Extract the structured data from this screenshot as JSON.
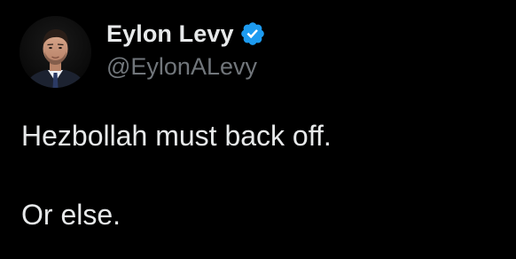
{
  "author": {
    "display_name": "Eylon Levy",
    "handle": "@EylonALevy",
    "verified": true,
    "avatar_icon": "profile-photo",
    "verified_icon": "verified-badge-icon"
  },
  "tweet": {
    "lines": [
      "Hezbollah must back off.",
      "Or else."
    ]
  },
  "colors": {
    "background": "#000000",
    "text_primary": "#e7e9ea",
    "text_secondary": "#71767b",
    "verified_badge": "#1d9bf0"
  }
}
